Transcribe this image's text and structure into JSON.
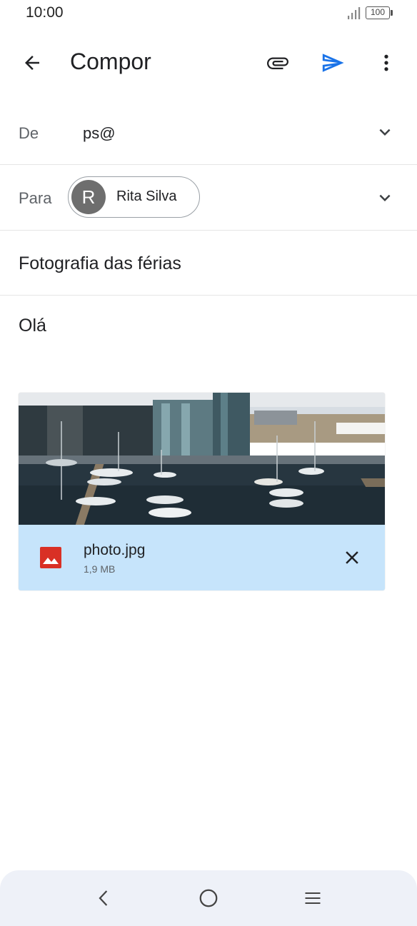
{
  "status": {
    "time": "10:00",
    "battery": "100"
  },
  "toolbar": {
    "title": "Compor",
    "icons": [
      "back-arrow-icon",
      "paperclip-icon",
      "send-icon",
      "more-vert-icon"
    ],
    "send_color": "#1a73e8"
  },
  "from": {
    "label": "De",
    "value": "ps@"
  },
  "to": {
    "label": "Para",
    "recipient_initial": "R",
    "recipient_name": "Rita Silva"
  },
  "subject": "Fotografia das férias",
  "body": "Olá",
  "attachment": {
    "filename": "photo.jpg",
    "size": "1,9 MB",
    "icon_color": "#d93025",
    "background": "#c6e4fb"
  },
  "navbar": {
    "icons": [
      "nav-back-icon",
      "nav-home-icon",
      "nav-menu-icon"
    ]
  }
}
